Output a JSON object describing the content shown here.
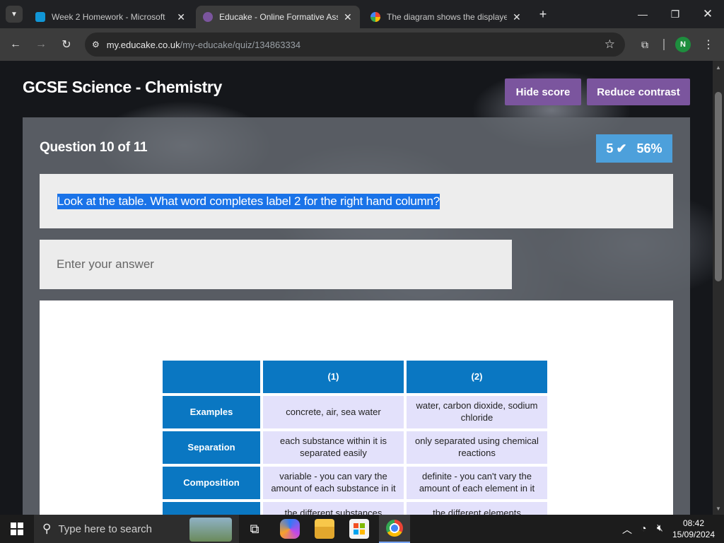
{
  "browser": {
    "tabs": [
      {
        "title": "Week 2 Homework - Microsoft",
        "active": false
      },
      {
        "title": "Educake - Online Formative Assessment",
        "active": true
      },
      {
        "title": "The diagram shows the displayed",
        "active": false
      }
    ],
    "url_domain": "my.educake.co.uk",
    "url_path": "/my-educake/quiz/134863334",
    "profile_initial": "N"
  },
  "page": {
    "title": "GCSE Science - Chemistry",
    "hide_score_label": "Hide score",
    "reduce_contrast_label": "Reduce contrast",
    "question_counter": "Question 10 of 11",
    "score_count": "5",
    "score_percent": "56%",
    "question_text": "Look at the table. What word completes label 2 for the right hand column?",
    "answer_placeholder": "Enter your answer"
  },
  "table": {
    "headers": [
      "",
      "(1)",
      "(2)"
    ],
    "rows": [
      {
        "label": "Examples",
        "col1": "concrete, air, sea water",
        "col2": "water, carbon dioxide, sodium chloride"
      },
      {
        "label": "Separation",
        "col1": "each substance within it is separated easily",
        "col2": "only separated using chemical reactions"
      },
      {
        "label": "Composition",
        "col1": "variable - you can vary the amount of each substance in it",
        "col2": "definite - you can't vary the amount of each element in it"
      },
      {
        "label": "",
        "col1": "the different substances",
        "col2": "the different elements"
      }
    ]
  },
  "taskbar": {
    "search_placeholder": "Type here to search",
    "time": "08:42",
    "date": "15/09/2024"
  },
  "colors": {
    "accent_purple": "#7b559e",
    "score_blue": "#4da0db",
    "table_header": "#0a77c2",
    "table_cell": "#e3e1fb"
  }
}
